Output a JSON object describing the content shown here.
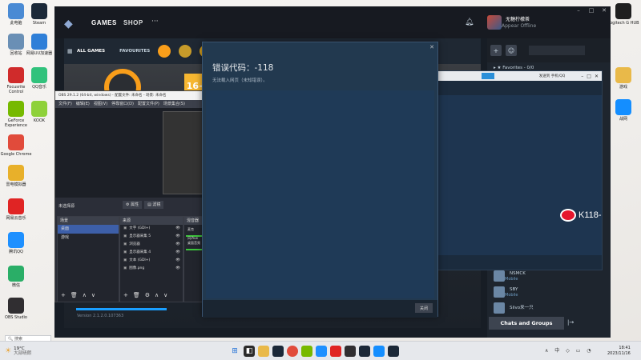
{
  "desktop": {
    "left_icons": [
      {
        "label": "此电脑",
        "icon": "computer-icon",
        "color": "#4a8ad4"
      },
      {
        "label": "Steam",
        "icon": "steam-icon",
        "color": "#1b2838"
      },
      {
        "label": "回收站",
        "icon": "recycle-bin-icon",
        "color": "#6a8fb5"
      },
      {
        "label": "网易UU加速器",
        "icon": "uu-icon",
        "color": "#2f7fd8"
      },
      {
        "label": "Focusrite Control",
        "icon": "focusrite-icon",
        "color": "#d02b2b"
      },
      {
        "label": "QQ音乐",
        "icon": "qqmusic-icon",
        "color": "#31c27c"
      },
      {
        "label": "GeForce Experience",
        "icon": "geforce-icon",
        "color": "#76b900"
      },
      {
        "label": "KOOK",
        "icon": "kook-icon",
        "color": "#8ed13a"
      },
      {
        "label": "Google Chrome",
        "icon": "chrome-icon",
        "color": "#e14b3b"
      },
      {
        "label": "雷电模拟器",
        "icon": "ldplayer-icon",
        "color": "#e8b02a"
      },
      {
        "label": "网易云音乐",
        "icon": "netease-music-icon",
        "color": "#e02424"
      },
      {
        "label": "腾讯QQ",
        "icon": "qq-icon",
        "color": "#1e90ff"
      },
      {
        "label": "微信",
        "icon": "wechat-icon",
        "color": "#2aae67"
      },
      {
        "label": "OBS Studio",
        "icon": "obs-icon",
        "color": "#302e31"
      }
    ],
    "right_icons": [
      {
        "label": "Logitech G HUB",
        "icon": "logitech-icon",
        "color": "#1f1f1f"
      },
      {
        "label": "游戏",
        "icon": "folder-icon",
        "color": "#e9b949"
      },
      {
        "label": "战网",
        "icon": "battlenet-icon",
        "color": "#148eff"
      }
    ]
  },
  "steam": {
    "nav": {
      "games": "GAMES",
      "shop": "SHOP",
      "more": "···"
    },
    "user": {
      "name": "无糖柠檬茶",
      "status": "Appear Offline"
    },
    "library": {
      "all_games": "ALL GAMES",
      "favourites": "FAVOURITES"
    },
    "hero": {
      "rating_badge": "16+",
      "version": "Version 2.1.2.0.107363"
    },
    "friends": {
      "favorites_header": "Favorites - 0/0",
      "list": [
        {
          "name": "NSMCK",
          "status": "Mobile"
        },
        {
          "name": "SBY",
          "status": "Mobile"
        },
        {
          "name": "Silvo来一只",
          "status": ""
        }
      ],
      "chats_button": "Chats and Groups"
    }
  },
  "chat_window": {
    "watermark": "K118-",
    "toolbar_text": "发送到 手机/QQ"
  },
  "obs": {
    "title": "OBS 29.1.2 (64-bit, windows) - 配置文件: 未命名 - 场景: 未命名",
    "menu": [
      "文件(F)",
      "编辑(E)",
      "视图(V)",
      "停靠窗口(D)",
      "配置文件(P)",
      "场景集合(S)"
    ],
    "no_source": "未选择源",
    "tabs": [
      "属性",
      "滤镜"
    ],
    "scenes_title": "场景",
    "scenes": [
      "桌面",
      "游戏"
    ],
    "sources_title": "来源",
    "sources": [
      "文字 (GDI+)",
      "显示器采集 5",
      "浏览器",
      "显示器采集 4",
      "文本 (GDI+)",
      "图像.png"
    ],
    "mixer_title": "混音器",
    "mixer_labels": [
      "麦克风/Aux",
      "桌面音频"
    ]
  },
  "error_dialog": {
    "title": "错误代码：-118",
    "description": "无法载入网页（未知错误）。",
    "ok": "关闭"
  },
  "taskbar": {
    "weather_temp": "19°C",
    "weather_desc": "大部晴朗",
    "search": "搜索",
    "time": "18:41",
    "date": "2023/11/16"
  }
}
